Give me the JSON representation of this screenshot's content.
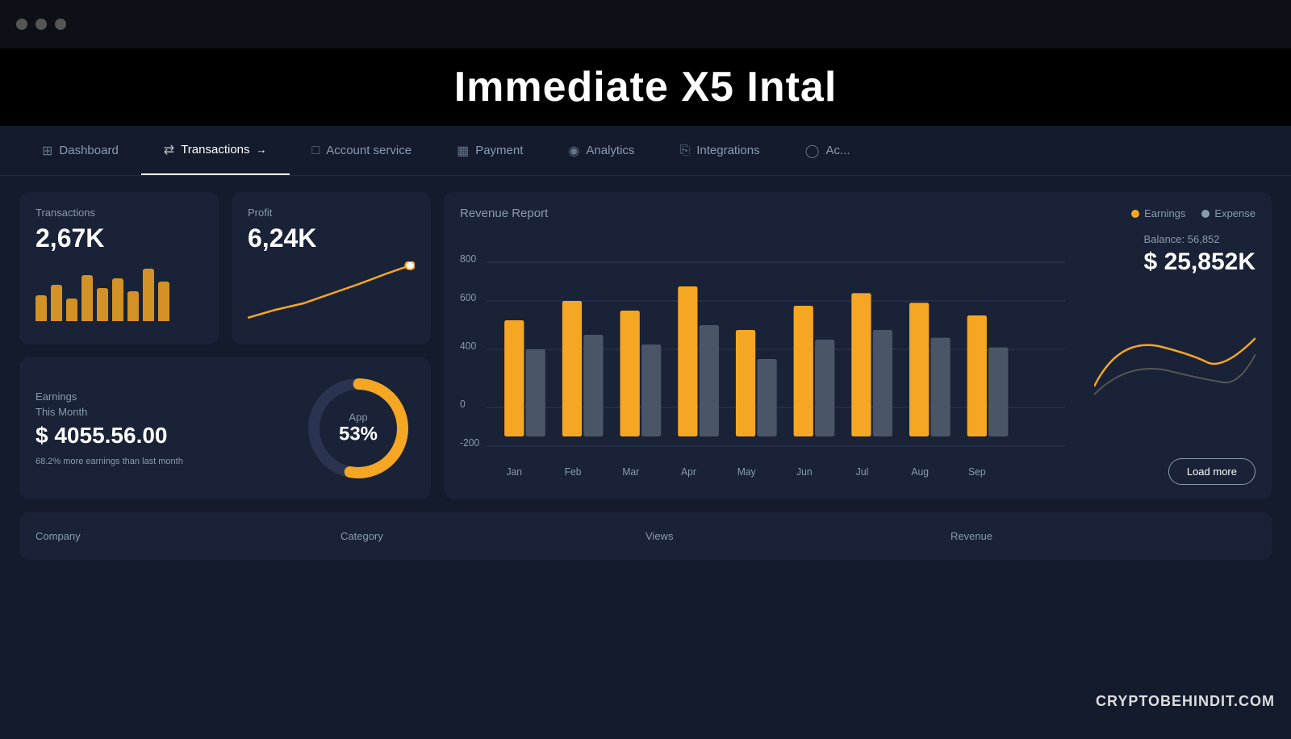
{
  "titleBar": {
    "dots": [
      "dot1",
      "dot2",
      "dot3"
    ]
  },
  "banner": {
    "text": "Immediate X5 Intal"
  },
  "nav": {
    "items": [
      {
        "id": "dashboard",
        "icon": "⊞",
        "label": "Dashboard",
        "active": false
      },
      {
        "id": "transactions",
        "icon": "⇄",
        "label": "Transactions",
        "active": true
      },
      {
        "id": "account-service",
        "icon": "□",
        "label": "Account service",
        "active": false
      },
      {
        "id": "payment",
        "icon": "▦",
        "label": "Payment",
        "active": false
      },
      {
        "id": "analytics",
        "icon": "◉",
        "label": "Analytics",
        "active": false
      },
      {
        "id": "integrations",
        "icon": "⎘",
        "label": "Integrations",
        "active": false
      },
      {
        "id": "ac",
        "icon": "◯",
        "label": "Ac...",
        "active": false
      }
    ]
  },
  "transactions": {
    "label": "Transactions",
    "value": "2,67K",
    "bars": [
      40,
      55,
      35,
      70,
      50,
      65,
      45,
      80,
      60
    ]
  },
  "profit": {
    "label": "Profit",
    "value": "6,24K"
  },
  "earnings": {
    "label": "Earnings",
    "sublabel": "This Month",
    "value": "$ 4055.56.00",
    "note": "68.2% more earnings than last month",
    "donut": {
      "label": "App",
      "percentage": "53%",
      "value": 53
    }
  },
  "revenueReport": {
    "title": "Revenue Report",
    "legend": [
      {
        "label": "Earnings",
        "color": "#f5a623"
      },
      {
        "label": "Expense",
        "color": "#8a9bb0"
      }
    ],
    "months": [
      "Jan",
      "Feb",
      "Mar",
      "Apr",
      "May",
      "Jun",
      "Jul",
      "Aug",
      "Sep"
    ],
    "earningsBars": [
      65,
      80,
      60,
      90,
      55,
      70,
      85,
      75,
      68
    ],
    "expenseBars": [
      40,
      50,
      35,
      55,
      30,
      45,
      52,
      48,
      42
    ],
    "yLabels": [
      "800",
      "600",
      "400",
      "0",
      "-200"
    ],
    "balance": {
      "label": "Balance: 56,852",
      "value": "$ 25,852K"
    },
    "loadMore": "Load more"
  },
  "table": {
    "columns": [
      "Company",
      "Category",
      "Views",
      "Revenue"
    ]
  },
  "watermark": "CRYPTOBEHINDIT.COM"
}
